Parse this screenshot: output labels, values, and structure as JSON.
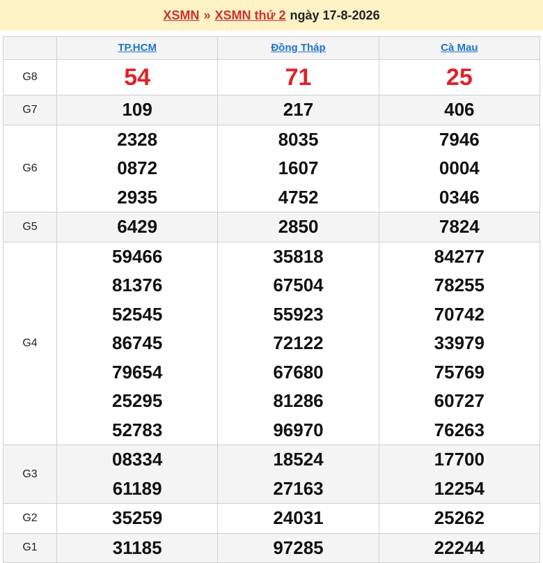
{
  "header": {
    "link1": "XSMN",
    "separator": "»",
    "link2": "XSMN thứ 2",
    "date_text": "ngày 17-8-2026"
  },
  "provinces": [
    "TP.HCM",
    "Đồng Tháp",
    "Cà Mau"
  ],
  "rows": [
    {
      "prize": "G8",
      "numbers": [
        [
          "54"
        ],
        [
          "71"
        ],
        [
          "25"
        ]
      ]
    },
    {
      "prize": "G7",
      "numbers": [
        [
          "109"
        ],
        [
          "217"
        ],
        [
          "406"
        ]
      ]
    },
    {
      "prize": "G6",
      "numbers": [
        [
          "2328",
          "0872",
          "2935"
        ],
        [
          "8035",
          "1607",
          "4752"
        ],
        [
          "7946",
          "0004",
          "0346"
        ]
      ]
    },
    {
      "prize": "G5",
      "numbers": [
        [
          "6429"
        ],
        [
          "2850"
        ],
        [
          "7824"
        ]
      ]
    },
    {
      "prize": "G4",
      "numbers": [
        [
          "59466",
          "81376",
          "52545",
          "86745",
          "79654",
          "25295",
          "52783"
        ],
        [
          "35818",
          "67504",
          "55923",
          "72122",
          "67680",
          "81286",
          "96970"
        ],
        [
          "84277",
          "78255",
          "70742",
          "33979",
          "75769",
          "60727",
          "76263"
        ]
      ]
    },
    {
      "prize": "G3",
      "numbers": [
        [
          "08334",
          "61189"
        ],
        [
          "18524",
          "27163"
        ],
        [
          "17700",
          "12254"
        ]
      ]
    },
    {
      "prize": "G2",
      "numbers": [
        [
          "35259"
        ],
        [
          "24031"
        ],
        [
          "25262"
        ]
      ]
    },
    {
      "prize": "G1",
      "numbers": [
        [
          "31185"
        ],
        [
          "97285"
        ],
        [
          "22244"
        ]
      ]
    }
  ],
  "colors": {
    "header_bg": "#fdf2c6",
    "link_red": "#d32f2f",
    "province_blue": "#1e73c8",
    "g8_red": "#e12128"
  }
}
